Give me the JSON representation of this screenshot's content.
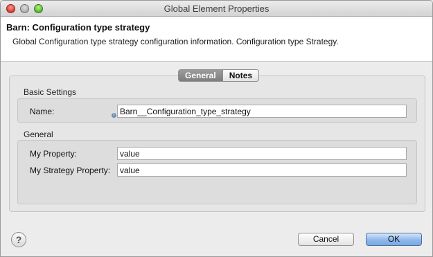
{
  "window": {
    "title": "Global Element Properties"
  },
  "header": {
    "title": "Barn: Configuration type strategy",
    "description": "Global Configuration type strategy configuration information. Configuration type Strategy."
  },
  "tabs": [
    {
      "label": "General",
      "active": true
    },
    {
      "label": "Notes",
      "active": false
    }
  ],
  "basic_settings": {
    "section_label": "Basic Settings",
    "name_label": "Name:",
    "name_value": "Barn__Configuration_type_strategy",
    "info_icon": "info-icon"
  },
  "general": {
    "section_label": "General",
    "my_property_label": "My Property:",
    "my_property_value": "value",
    "my_strategy_property_label": "My Strategy Property:",
    "my_strategy_property_value": "value"
  },
  "footer": {
    "help_icon": "?",
    "cancel_label": "Cancel",
    "ok_label": "OK"
  },
  "colors": {
    "ok_accent": "#8db7ea",
    "tab_active": "#8a8a8a"
  }
}
